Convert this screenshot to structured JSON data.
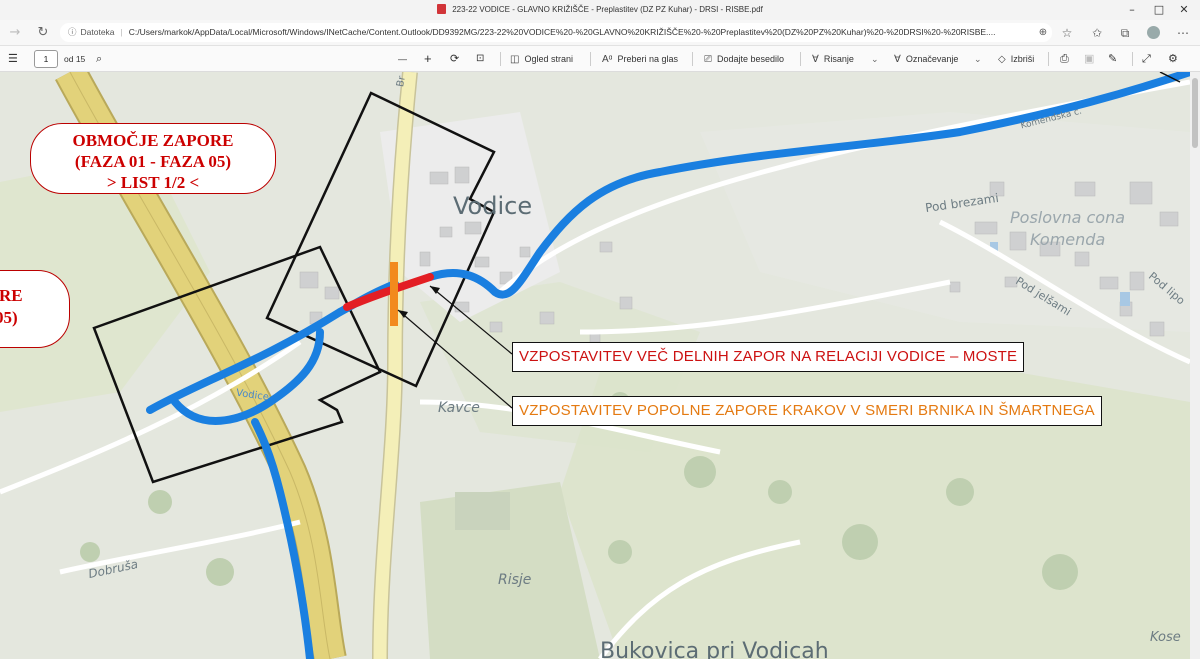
{
  "window": {
    "title": "223-22 VODICE - GLAVNO KRIŽIŠČE - Preplastitev (DZ PZ Kuhar) - DRSI - RISBE.pdf",
    "controls": [
      "–",
      "□",
      "✕"
    ]
  },
  "address_bar": {
    "scheme_label": "Datoteka",
    "url": "C:/Users/markok/AppData/Local/Microsoft/Windows/INetCache/Content.Outlook/DD9392MG/223-22%20VODICE%20-%20GLAVNO%20KRIŽIŠČE%20-%20Preplastitev%20(DZ%20PZ%20Kuhar)%20-%20DRSI%20-%20RISBE....",
    "icons": [
      "back-icon",
      "refresh-icon",
      "info-icon",
      "zoom-icon",
      "favorite-icon",
      "favorites-bar-icon",
      "collections-icon",
      "profile-icon",
      "more-icon"
    ]
  },
  "pdf_toolbar": {
    "page_current": "1",
    "page_total": "od 15",
    "zoom_out": "—",
    "zoom_in": "+",
    "view_label": "Ogled strani",
    "read_aloud_label": "Preberi na glas",
    "add_text_label": "Dodajte besedilo",
    "draw_label": "Risanje",
    "highlight_label": "Označevanje",
    "erase_label": "Izbriši"
  },
  "map": {
    "callout_main": {
      "line1": "OBMOČJE ZAPORE",
      "line2": "(FAZA 01 - FAZA 05)",
      "line3": "> LIST 1/2 <"
    },
    "callout_left": {
      "line1": "RE",
      "line2": "05)"
    },
    "annotation_1": "VZPOSTAVITEV VEČ DELNIH ZAPOR NA RELACIJI VODICE – MOSTE",
    "annotation_2": "VZPOSTAVITEV POPOLNE ZAPORE KRAKOV V SMERI BRNIKA IN ŠMARTNEGA",
    "colors": {
      "route": "#1a7fe0",
      "full_closure": "#e31e24",
      "barrier": "#f28a1d",
      "annotation_1_text": "#cc1111",
      "annotation_2_text": "#e47a12",
      "highway": "#d8c96a"
    },
    "place_labels": {
      "vodice": "Vodice",
      "kavce": "Kavce",
      "risje": "Risje",
      "dobrusa": "Dobruša",
      "bukovica": "Bukovica pri Vodicah",
      "pod_brezami": "Pod brezami",
      "poslovna_cona": "Poslovna cona",
      "komenda": "Komenda",
      "pod_jelsami": "Pod jelšami",
      "pod_lipo": "Pod lipo",
      "kose": "Kose",
      "road_vodice": "Vodice",
      "road_top": "Br",
      "road_ne": "Komendska c."
    }
  }
}
